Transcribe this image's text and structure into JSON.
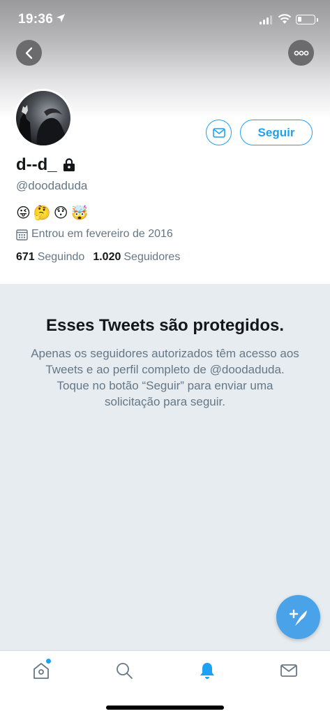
{
  "status_bar": {
    "time": "19:36"
  },
  "profile": {
    "display_name": "d--d_",
    "handle": "@doodaduda",
    "emojis": [
      "😜",
      "🤔",
      "😯",
      "🤯"
    ],
    "joined": "Entrou em fevereiro de 2016",
    "following_count": "671",
    "following_label": "Seguindo",
    "followers_count": "1.020",
    "followers_label": "Seguidores"
  },
  "actions": {
    "follow_label": "Seguir"
  },
  "protected": {
    "title": "Esses Tweets são protegidos.",
    "body": "Apenas os seguidores autorizados têm acesso aos Tweets e ao perfil completo de @doodaduda. Toque no botão “Seguir” para enviar uma solicitação para seguir."
  },
  "tabs": [
    {
      "name": "home",
      "icon": "home-icon",
      "active": false,
      "badge": true
    },
    {
      "name": "search",
      "icon": "search-icon",
      "active": false,
      "badge": false
    },
    {
      "name": "notifications",
      "icon": "bell-icon",
      "active": true,
      "badge": false
    },
    {
      "name": "messages",
      "icon": "mail-icon",
      "active": false,
      "badge": false
    }
  ],
  "colors": {
    "accent": "#1da1f2",
    "fab": "#4aa3e8",
    "protected_bg": "#e6ecf0",
    "secondary_text": "#657786"
  }
}
